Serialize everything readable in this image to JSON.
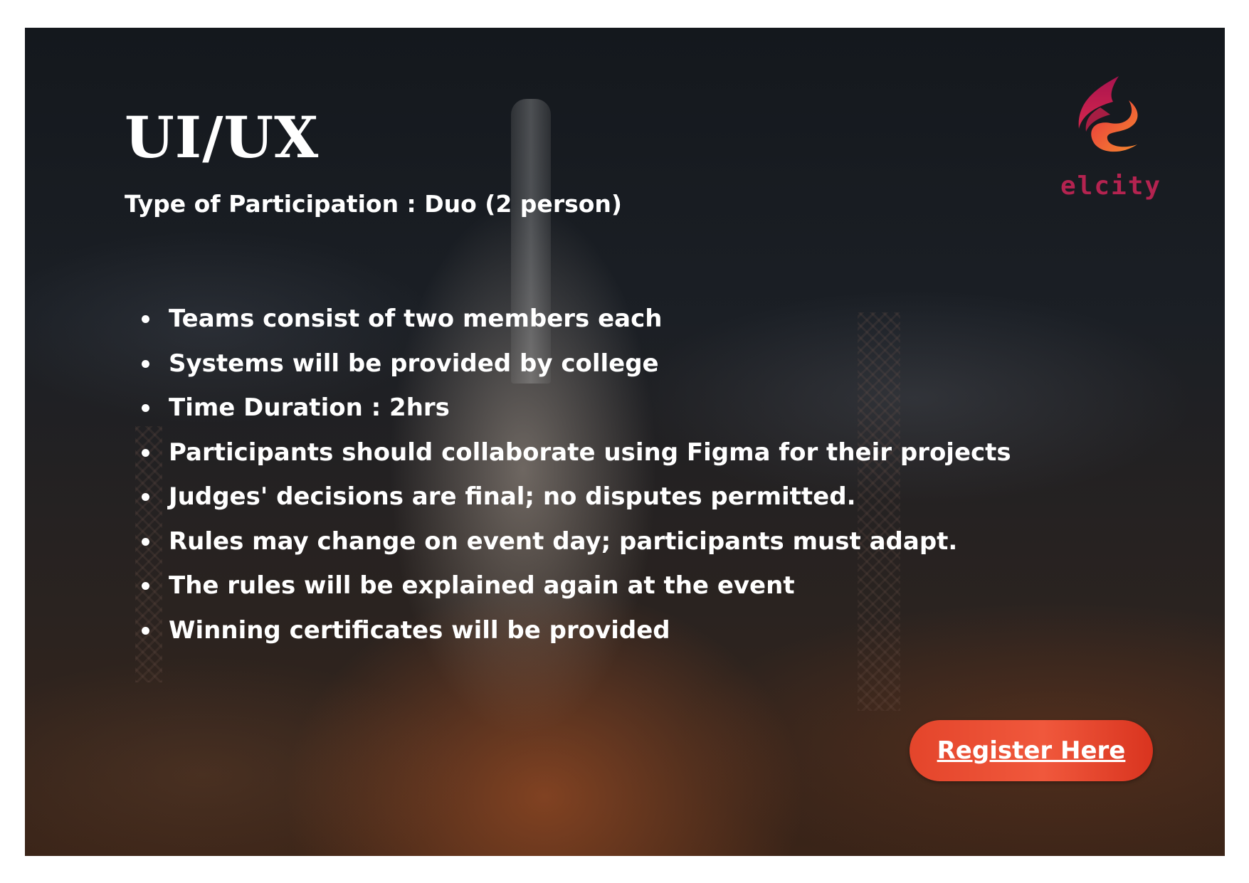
{
  "event": {
    "title": "UI/UX",
    "participation": "Type of Participation : Duo (2 person)"
  },
  "rules": [
    "Teams consist of two members each",
    "Systems will be provided by college",
    "Time Duration : 2hrs",
    "Participants should collaborate using Figma for their projects",
    "Judges' decisions are final; no disputes permitted.",
    "Rules may change on event day; participants must adapt.",
    "The rules will be explained again at the event",
    "Winning certificates will be provided"
  ],
  "register_button": {
    "label": "Register Here"
  },
  "logo": {
    "text": "elcity",
    "icon": "flame-icon"
  },
  "colors": {
    "accent": "#e4452b",
    "logo_text": "#b42350",
    "flame_top": "#a8144f",
    "flame_bottom": "#f26a2e"
  }
}
